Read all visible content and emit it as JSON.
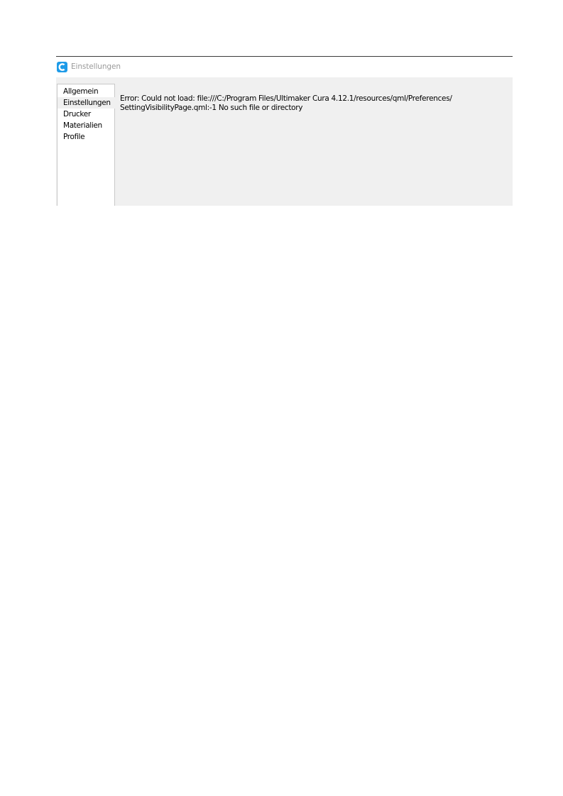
{
  "window": {
    "title": "Einstellungen",
    "icon": "cura-logo-icon",
    "accent_color": "#1e9be8"
  },
  "sidebar": {
    "items": [
      {
        "label": "Allgemein",
        "selected": false
      },
      {
        "label": "Einstellungen",
        "selected": true
      },
      {
        "label": "Drucker",
        "selected": false
      },
      {
        "label": "Materialien",
        "selected": false
      },
      {
        "label": "Profile",
        "selected": false
      }
    ]
  },
  "content": {
    "error_line1": "Error: Could not load: file:///C:/Program Files/Ultimaker Cura 4.12.1/resources/qml/Preferences/",
    "error_line2": "SettingVisibilityPage.qml:-1 No such file or directory"
  }
}
